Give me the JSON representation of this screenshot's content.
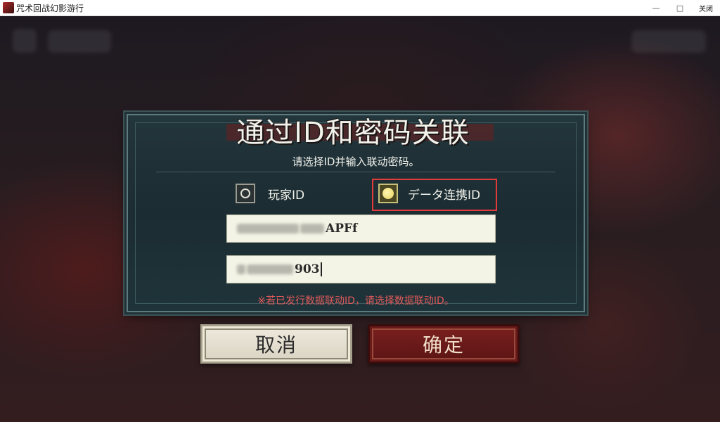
{
  "window": {
    "title": "咒术回战幻影游行",
    "minimize": "—",
    "maximize": "□",
    "close": "关闭"
  },
  "dialog": {
    "title": "通过ID和密码关联",
    "subtitle": "请选择ID并输入联动密码。",
    "options": [
      {
        "label": "玩家ID",
        "selected": false
      },
      {
        "label": "データ连携ID",
        "selected": true
      }
    ],
    "id_field": {
      "visible_tail": "Ff",
      "partial": "APFf"
    },
    "password_field": {
      "visible_tail": "903"
    },
    "note": "※若已发行数据联动ID，请选择数据联动ID。"
  },
  "buttons": {
    "cancel": "取消",
    "confirm": "确定"
  },
  "colors": {
    "highlight": "#e23b3b",
    "note": "#e05a5a",
    "confirm_bg": "#6b1a1a",
    "cancel_bg": "#e6e1d2"
  }
}
